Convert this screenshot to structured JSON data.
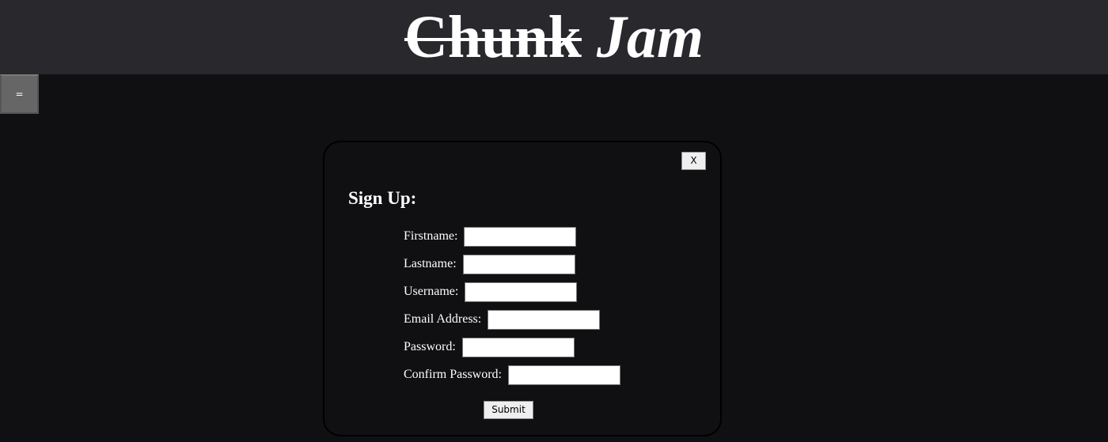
{
  "header": {
    "title_strike": "Chunk",
    "title_italic": "Jam"
  },
  "menu": {
    "toggle_label": "="
  },
  "signup": {
    "close_label": "X",
    "title": "Sign Up:",
    "fields": [
      {
        "label": "Firstname:",
        "value": "",
        "placeholder": ""
      },
      {
        "label": "Lastname:",
        "value": "",
        "placeholder": ""
      },
      {
        "label": "Username:",
        "value": "",
        "placeholder": ""
      },
      {
        "label": "Email Address:",
        "value": "",
        "placeholder": ""
      },
      {
        "label": "Password:",
        "value": "",
        "placeholder": ""
      },
      {
        "label": "Confirm Password:",
        "value": "",
        "placeholder": ""
      }
    ],
    "submit_label": "Submit"
  },
  "colors": {
    "page_background": "#100f12",
    "header_background": "#29282c",
    "menu_button_background": "#666666",
    "text": "#ffffff"
  }
}
